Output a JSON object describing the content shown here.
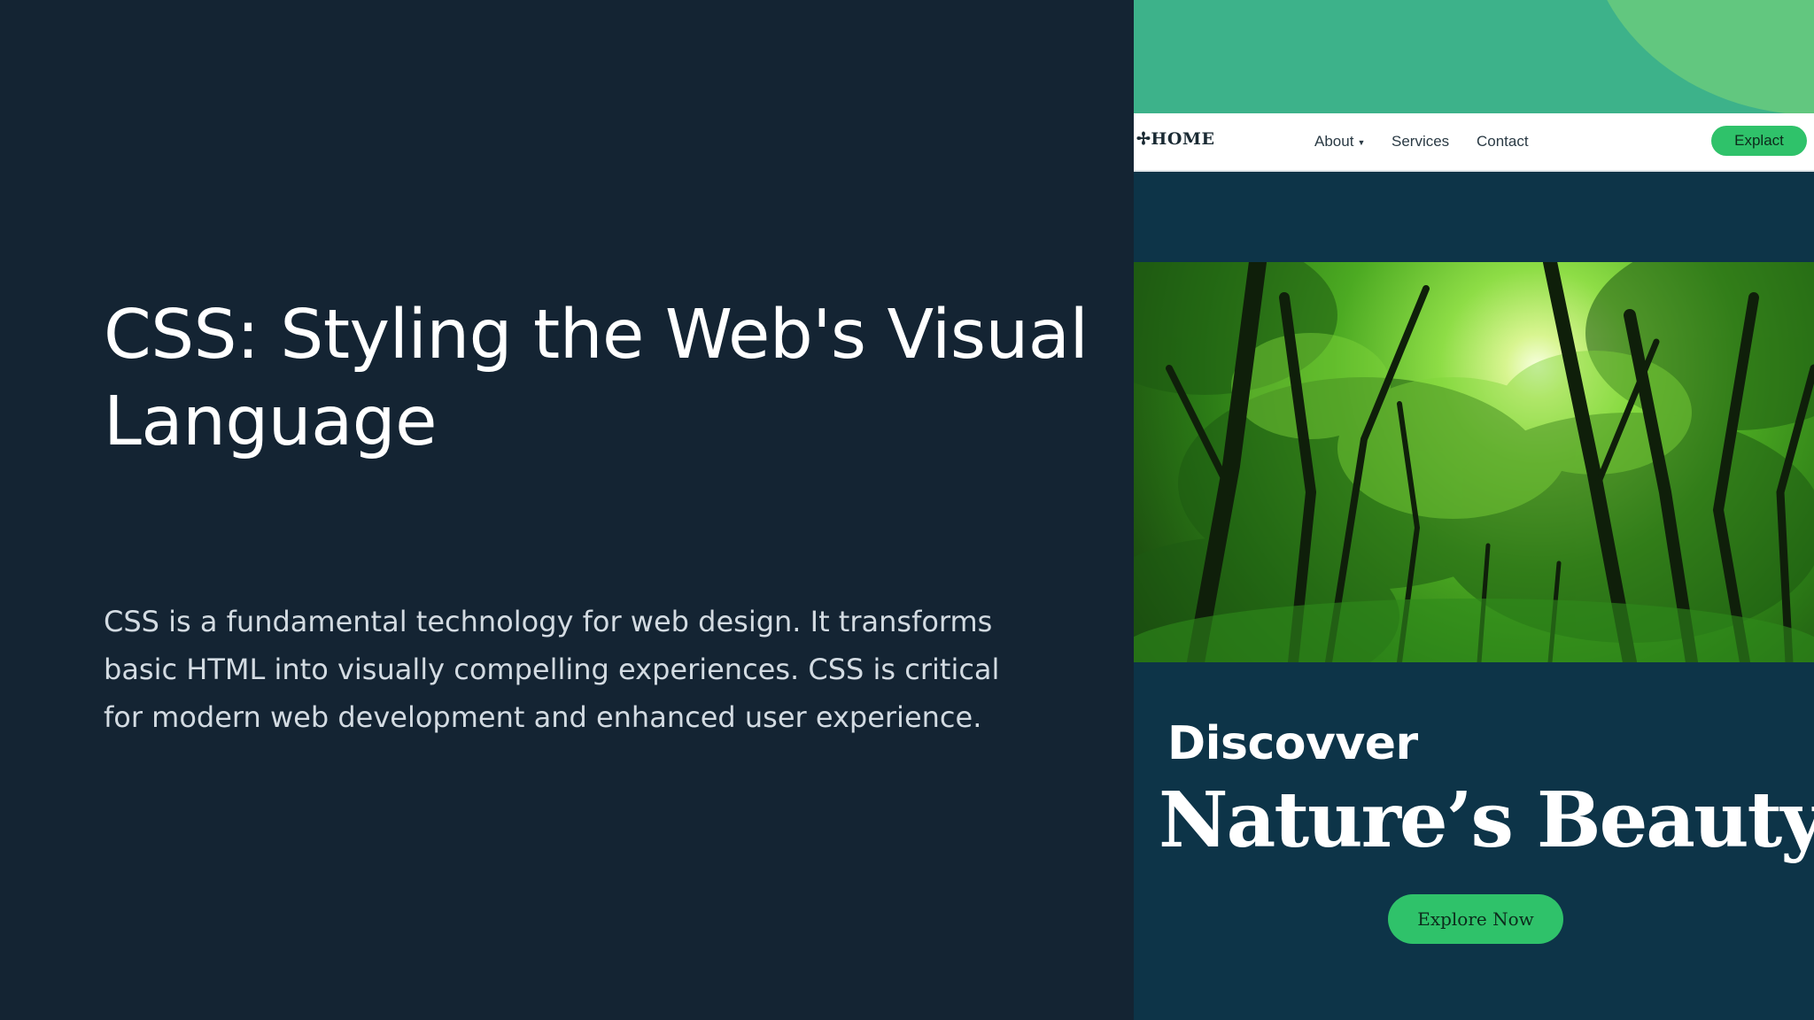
{
  "slide": {
    "title": "CSS: Styling the Web's Visual Language",
    "body": "CSS is a fundamental technology for web design. It transforms basic HTML into visually compelling experiences. CSS is critical for modern web development and enhanced user experience."
  },
  "mockup": {
    "nav": {
      "logo": "✢HOME",
      "about": "About",
      "services": "Services",
      "contact": "Contact",
      "cta": "Explact"
    },
    "hero": {
      "kicker": "Discovver",
      "headline": "Nature’s Beauty",
      "cta": "Explore Now"
    }
  },
  "colors": {
    "slide_background": "#142433",
    "mockup_background": "#0d3448",
    "accent_green": "#2fc26a",
    "top_band_green": "#3db28a"
  },
  "icons": {
    "about_dropdown": "chevron-down-icon"
  }
}
